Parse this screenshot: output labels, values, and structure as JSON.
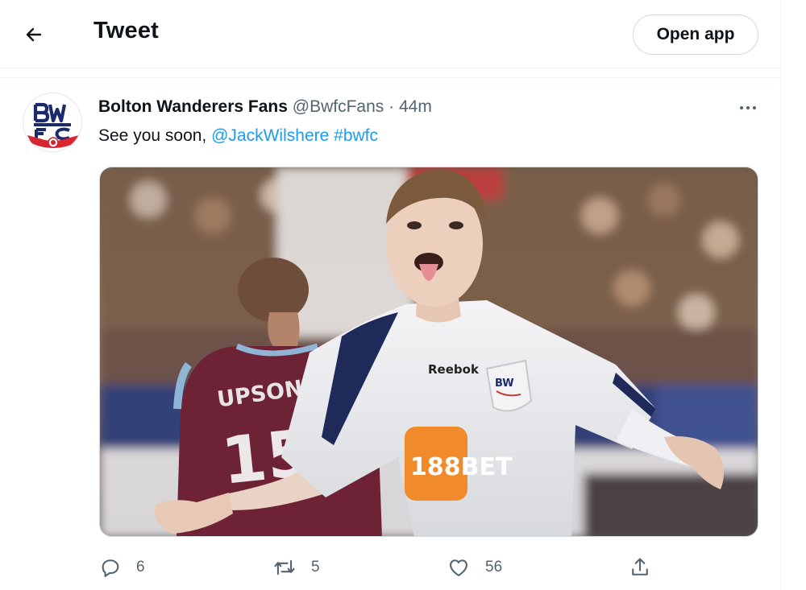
{
  "header": {
    "title": "Tweet",
    "open_app_label": "Open app",
    "back_icon": "arrow-left-icon"
  },
  "tweet": {
    "author_name": "Bolton Wanderers Fans",
    "author_handle": "@BwfcFans",
    "separator": "·",
    "time": "44m",
    "text_prefix": "See you soon, ",
    "mention": "@JackWilshere",
    "hashtag": "#bwfc",
    "avatar_logo_text": "BWFC",
    "media": {
      "shirt_sponsor": "Reebok",
      "shirt_ad": "188BET",
      "opponent_name": "UPSON",
      "opponent_number": "15"
    }
  },
  "actions": {
    "reply_count": "6",
    "retweet_count": "5",
    "like_count": "56"
  },
  "colors": {
    "link": "#1d9bf0",
    "muted": "#536471",
    "text": "#0f1419",
    "border": "#eff3f4"
  }
}
